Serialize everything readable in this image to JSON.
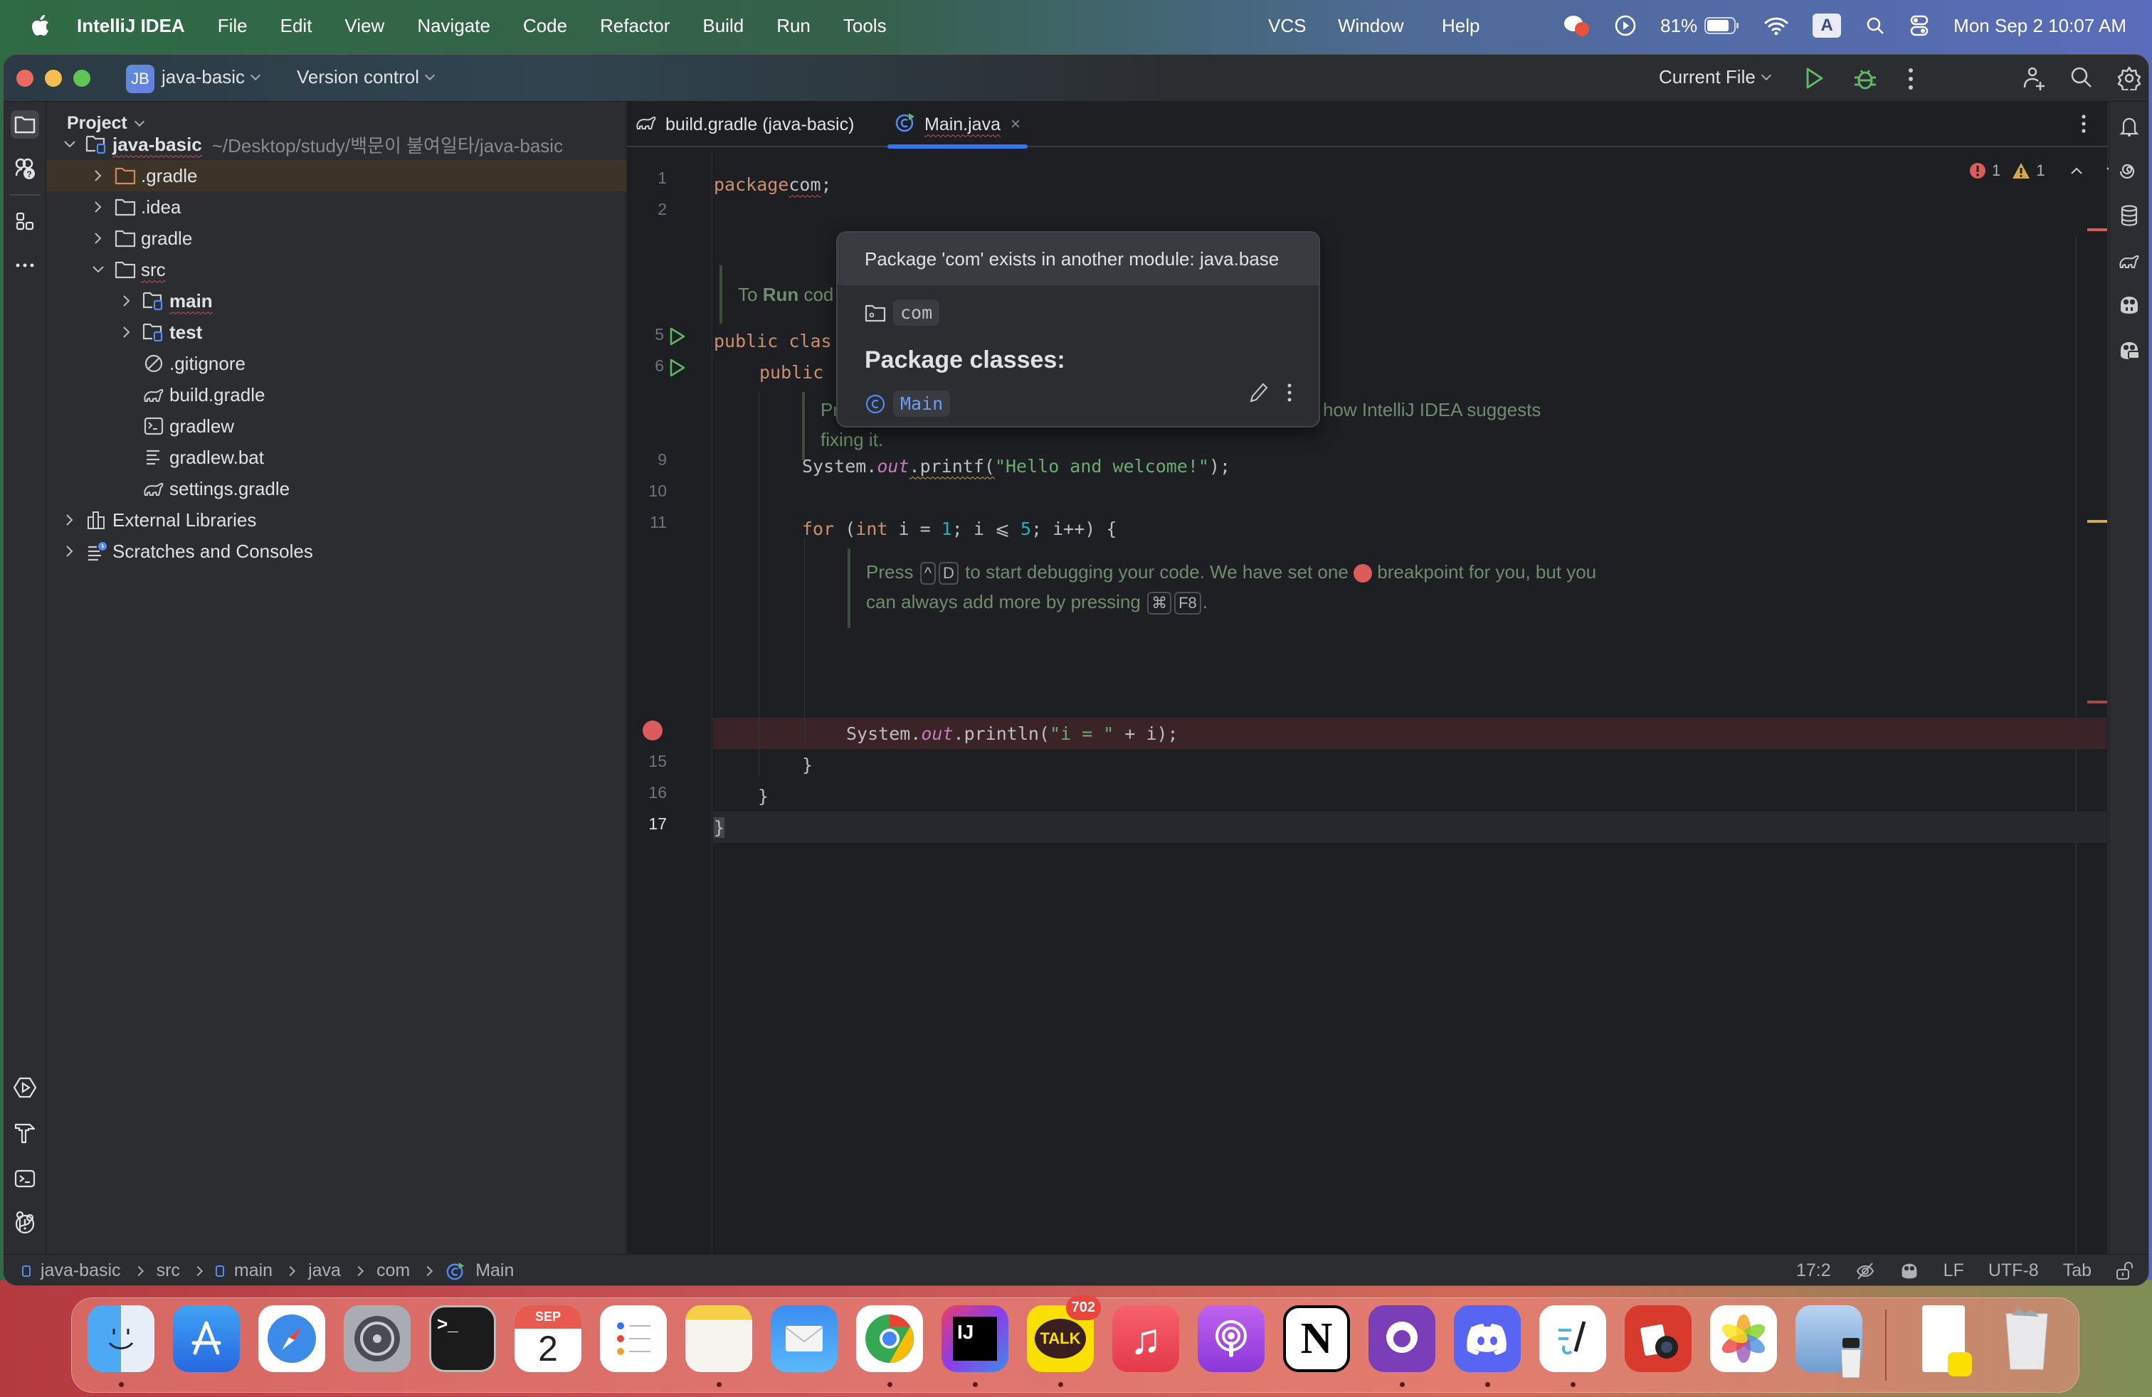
{
  "menubar": {
    "app_name": "IntelliJ IDEA",
    "menus": [
      "File",
      "Edit",
      "View",
      "Navigate",
      "Code",
      "Refactor",
      "Build",
      "Run",
      "Tools",
      "VCS",
      "Window",
      "Help"
    ],
    "battery": "81%",
    "input_source": "A",
    "datetime": "Mon Sep 2  10:07 AM"
  },
  "titlebar": {
    "project_badge": "JB",
    "project_name": "java-basic",
    "vcs": "Version control",
    "run_config": "Current File"
  },
  "project_panel": {
    "title": "Project",
    "tree": [
      {
        "label": "java-basic",
        "hint": "~/Desktop/study/백문이 불여일타/java-basic",
        "level": 0,
        "expanded": true,
        "icon": "module-folder-icon",
        "bold": true,
        "error": true
      },
      {
        "label": ".gradle",
        "level": 1,
        "expanded": false,
        "icon": "folder-icon",
        "selected": true,
        "excluded": true
      },
      {
        "label": ".idea",
        "level": 1,
        "expanded": false,
        "icon": "folder-icon"
      },
      {
        "label": "gradle",
        "level": 1,
        "expanded": false,
        "icon": "folder-icon"
      },
      {
        "label": "src",
        "level": 1,
        "expanded": true,
        "icon": "folder-icon",
        "error": true
      },
      {
        "label": "main",
        "level": 2,
        "expanded": false,
        "icon": "module-folder-icon",
        "bold": true,
        "error": true
      },
      {
        "label": "test",
        "level": 2,
        "expanded": false,
        "icon": "module-folder-icon",
        "bold": true
      },
      {
        "label": ".gitignore",
        "level": 2,
        "icon": "ignore-file-icon"
      },
      {
        "label": "build.gradle",
        "level": 2,
        "icon": "gradle-icon"
      },
      {
        "label": "gradlew",
        "level": 2,
        "icon": "shell-script-icon"
      },
      {
        "label": "gradlew.bat",
        "level": 2,
        "icon": "text-file-icon"
      },
      {
        "label": "settings.gradle",
        "level": 2,
        "icon": "gradle-icon"
      },
      {
        "label": "External Libraries",
        "level": 0,
        "expanded": false,
        "icon": "library-icon"
      },
      {
        "label": "Scratches and Consoles",
        "level": 0,
        "expanded": false,
        "icon": "scratches-icon"
      }
    ]
  },
  "editor": {
    "tabs": [
      {
        "label": "build.gradle (java-basic)",
        "icon": "gradle-icon",
        "active": false
      },
      {
        "label": "Main.java",
        "icon": "java-class-icon",
        "active": true
      }
    ],
    "inspections": {
      "errors": "1",
      "warnings": "1"
    },
    "line_numbers": {
      "l1": "1",
      "l2": "2",
      "l5": "5",
      "l6": "6",
      "l9": "9",
      "l10": "10",
      "l11": "11",
      "l15": "15",
      "l16": "16",
      "l17": "17"
    },
    "code": {
      "line1_kw": "package",
      "line1_pkg": "com",
      "line1_end": ";",
      "line5": "public clas",
      "line6": "public",
      "line9_a": "System.",
      "line9_fld": "out",
      "line9_b": ".printf(",
      "line9_str": "\"Hello and welcome!\"",
      "line9_c": ");",
      "line11_kw1": "for",
      "line11_a": " (",
      "line11_kw2": "int",
      "line11_b": " i = ",
      "line11_n1": "1",
      "line11_c": "; i ⩽ ",
      "line11_n2": "5",
      "line11_d": "; i++) {",
      "line14_a": "System.",
      "line14_fld": "out",
      "line14_b": ".println(",
      "line14_str": "\"i = \"",
      "line14_c": " + i);",
      "line15": "}",
      "line16": "}",
      "line17": "}"
    },
    "hints": {
      "run_hint_a": "To ",
      "run_hint_b": "Run",
      "run_hint_c": " cod",
      "fix_hint_a": "Pr",
      "fix_hint_b": "ext to see how IntelliJ IDEA suggests",
      "fix_hint_c": "fixing it.",
      "debug_a": "Press",
      "debug_k1": "^",
      "debug_k2": "D",
      "debug_b": "to start debugging your code. We have set one",
      "debug_c": "breakpoint for you, but you",
      "debug_d": "can always add more by pressing",
      "debug_k3": "⌘",
      "debug_k4": "F8",
      "debug_e": "."
    }
  },
  "popup": {
    "title": "Package 'com' exists in another module: java.base",
    "package_name": "com",
    "section_title": "Package classes:",
    "class_name": "Main"
  },
  "status_bar": {
    "breadcrumbs": [
      "java-basic",
      "src",
      "main",
      "java",
      "com",
      "Main"
    ],
    "position": "17:2",
    "line_ending": "LF",
    "encoding": "UTF-8",
    "indent": "Tab"
  },
  "dock": {
    "apps": [
      "Finder",
      "App Store",
      "Safari",
      "System Settings",
      "Terminal",
      "Calendar",
      "Reminders",
      "Notes",
      "Mail",
      "Chrome",
      "IntelliJ IDEA",
      "KakaoTalk",
      "Music",
      "Podcasts",
      "Notion",
      "GitHub Desktop",
      "Discord",
      "Freeform",
      "Photo Booth",
      "Photos",
      "Preview",
      "KakaoTalk Window",
      "Trash"
    ],
    "calendar_month": "SEP",
    "calendar_day": "2",
    "kakaotalk_badge": "702",
    "kakao_label": "TALK",
    "intellij_label": "IJ"
  }
}
